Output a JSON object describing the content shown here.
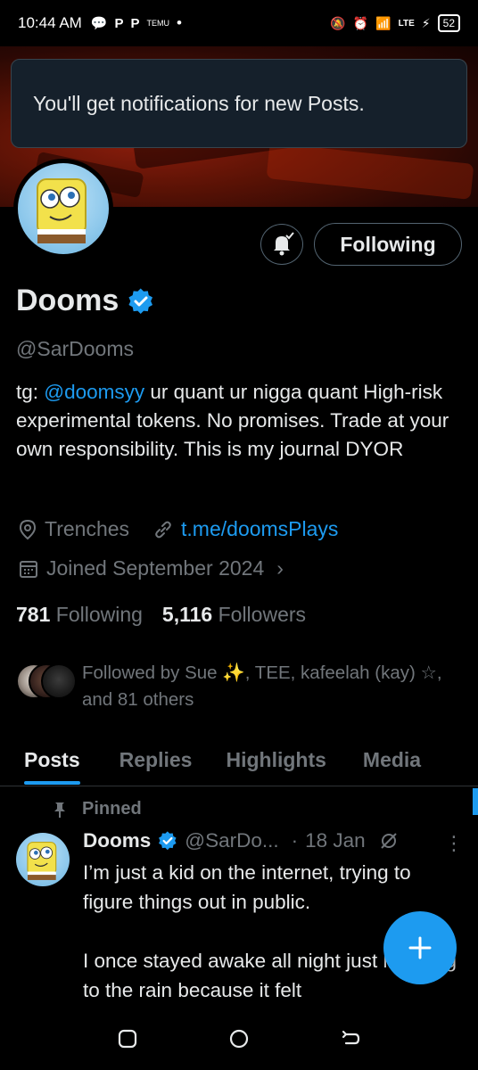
{
  "status_bar": {
    "time": "10:44 AM",
    "left_icons": [
      "chat-icon",
      "p-icon",
      "p-icon",
      "temu-icon"
    ],
    "temu_label": "TEMU",
    "network": "LTE",
    "battery": "52"
  },
  "toast": {
    "message": "You'll get notifications for new Posts."
  },
  "profile": {
    "name": "Dooms",
    "handle": "@SarDooms",
    "verified": true,
    "follow_button": "Following",
    "bio_prefix": "tg: ",
    "bio_mention": "@doomsyy",
    "bio_rest": " ur quant  ur nigga quant High-risk experimental tokens. No promises. Trade at your own responsibility.  This is my journal  DYOR",
    "location": "Trenches",
    "website": "t.me/doomsPlays",
    "joined": "Joined September 2024",
    "following_count": "781",
    "following_label": "Following",
    "followers_count": "5,116",
    "followers_label": "Followers",
    "followed_by": "Followed by Sue ✨, TEE, kafeelah (kay) ☆, and 81 others"
  },
  "tabs": [
    {
      "label": "Posts",
      "active": true
    },
    {
      "label": "Replies",
      "active": false
    },
    {
      "label": "Highlights",
      "active": false
    },
    {
      "label": "Media",
      "active": false
    }
  ],
  "pinned_label": "Pinned",
  "post": {
    "name": "Dooms",
    "handle": "@SarDo...",
    "dot": "·",
    "date": "18 Jan",
    "more": "⋮",
    "text": "I’m just a kid on the internet, trying to figure things out in public.\n\nI once stayed awake all night just listening to the rain because it felt"
  },
  "colors": {
    "accent": "#1d9bf0",
    "background": "#000000",
    "text_primary": "#e7e9ea",
    "text_secondary": "#71767b",
    "toast_bg": "#15202b"
  }
}
